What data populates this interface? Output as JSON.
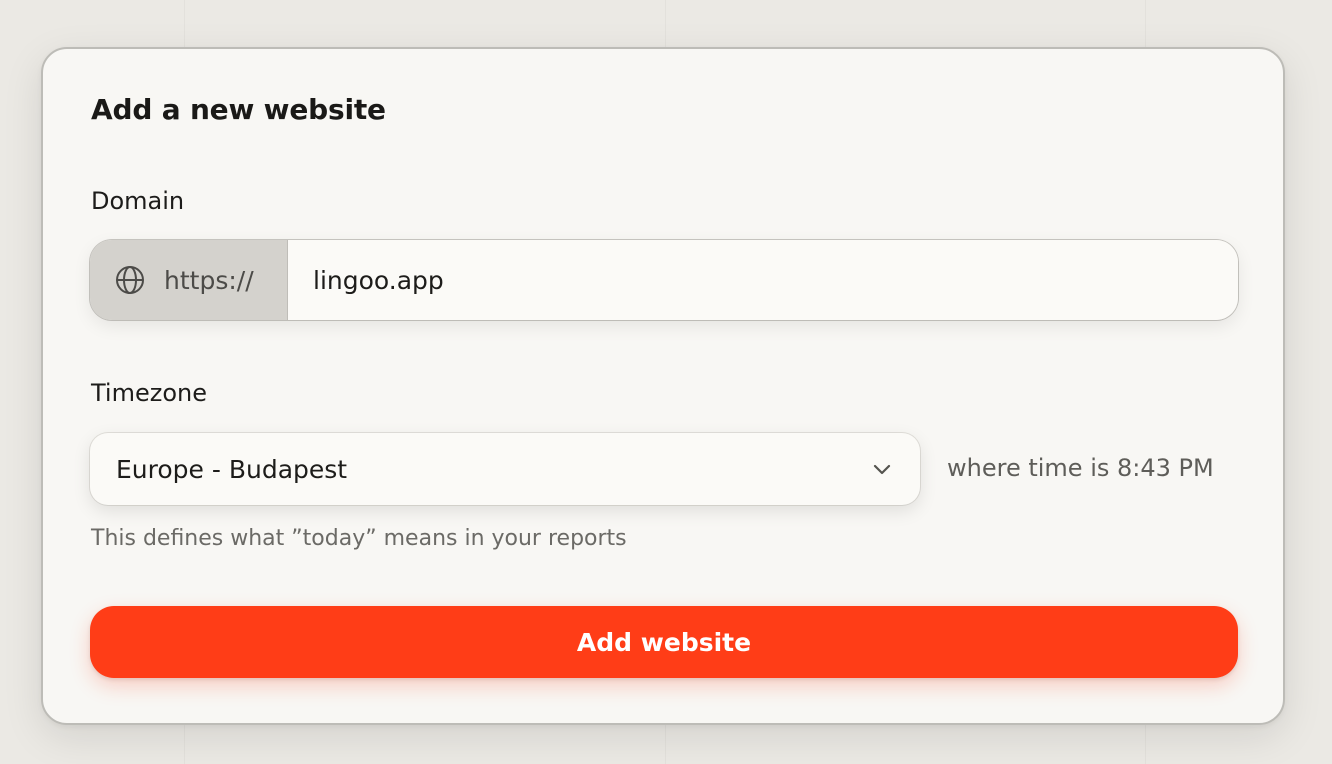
{
  "form": {
    "title": "Add a new website",
    "domain": {
      "label": "Domain",
      "prefix": "https://",
      "prefix_icon": "globe-icon",
      "value": "lingoo.app"
    },
    "timezone": {
      "label": "Timezone",
      "selected": "Europe - Budapest",
      "note": "where time is 8:43 PM",
      "helper": "This defines what ”today” means in your reports",
      "dropdown_icon": "chevron-down-icon"
    },
    "submit_label": "Add website"
  },
  "colors": {
    "accent": "#ff3d17",
    "card_background": "#f8f7f4",
    "page_background": "#ebe9e4",
    "prefix_background": "#d4d2cd"
  }
}
